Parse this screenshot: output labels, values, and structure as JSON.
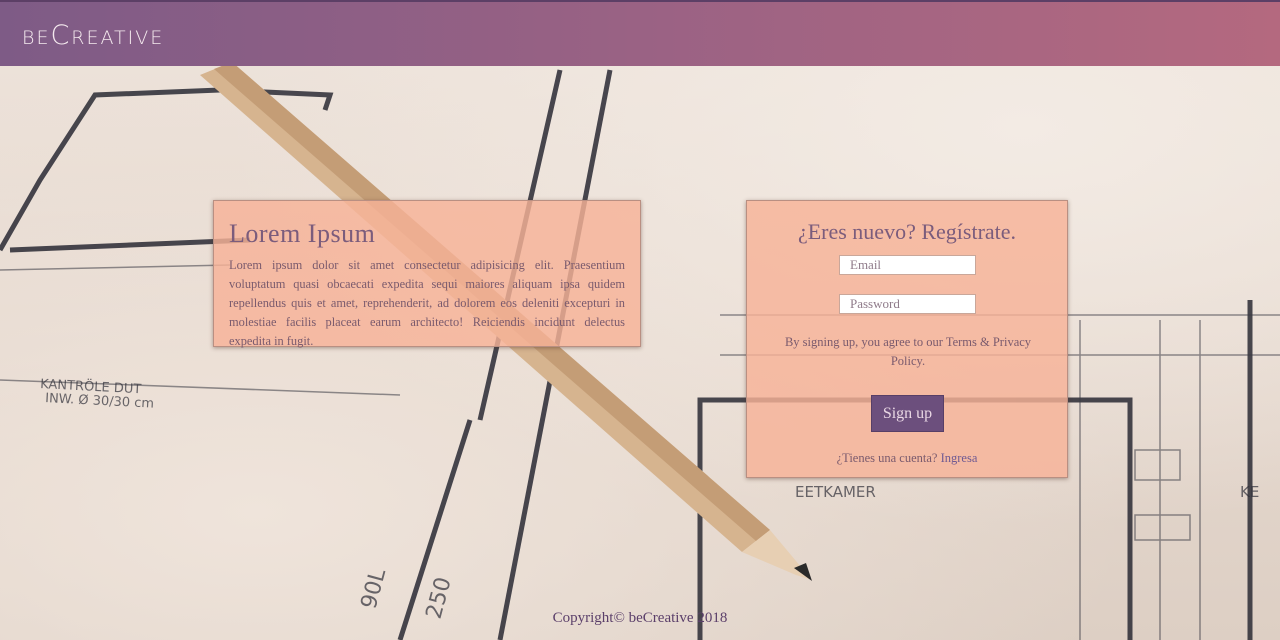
{
  "header": {
    "logo": "beCreative"
  },
  "info_card": {
    "title": "Lorem Ipsum",
    "body": "Lorem ipsum dolor sit amet consectetur adipisicing elit. Praesentium voluptatum quasi obcaecati expedita sequi maiores aliquam ipsa quidem repellendus quis et amet, reprehenderit, ad dolorem eos deleniti excepturi in molestiae facilis placeat earum architecto! Reiciendis incidunt delectus expedita in fugit."
  },
  "signup_card": {
    "title": "¿Eres nuevo? Regístrate.",
    "email_placeholder": "Email",
    "email_value": "",
    "password_placeholder": "Password",
    "password_value": "",
    "terms": "By signing up, you agree to our Terms & Privacy Policy.",
    "button_label": "Sign up",
    "login_prompt": "¿Tienes una cuenta?",
    "login_link": "Ingresa"
  },
  "footer": {
    "copyright": "Copyright© beCreative 2018"
  },
  "colors": {
    "header_start": "#7e5b86",
    "header_end": "#b4697f",
    "card_bg": "#f6b297",
    "button_bg": "#6c4f7d",
    "text": "#7a5a6d"
  }
}
